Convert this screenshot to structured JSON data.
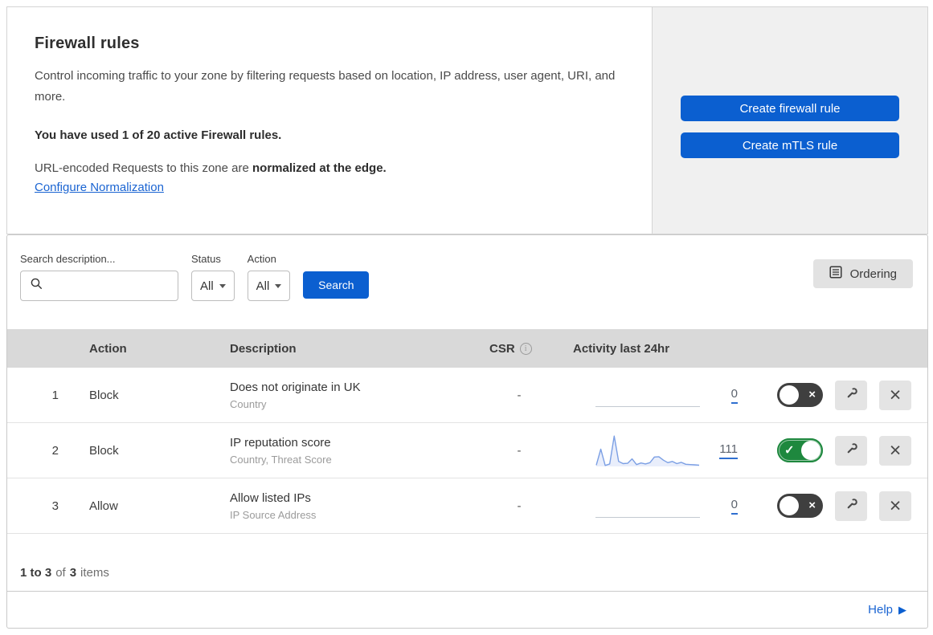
{
  "header": {
    "title": "Firewall rules",
    "description": "Control incoming traffic to your zone by filtering requests based on location, IP address, user agent, URI, and more.",
    "usage_line": "You have used 1 of 20 active Firewall rules.",
    "normalization_text": "URL-encoded Requests to this zone are ",
    "normalization_bold": "normalized at the edge.",
    "normalization_link": "Configure Normalization",
    "buttons": [
      {
        "label": "Create firewall rule"
      },
      {
        "label": "Create mTLS rule"
      }
    ]
  },
  "filters": {
    "search_label": "Search description...",
    "status_label": "Status",
    "status_value": "All",
    "action_label": "Action",
    "action_value": "All",
    "search_button": "Search",
    "ordering_button": "Ordering"
  },
  "table": {
    "columns": {
      "action": "Action",
      "description": "Description",
      "csr": "CSR",
      "activity": "Activity last 24hr"
    },
    "rows": [
      {
        "num": "1",
        "action": "Block",
        "title": "Does not originate in UK",
        "subtitle": "Country",
        "csr": "-",
        "count": "0",
        "enabled": false
      },
      {
        "num": "2",
        "action": "Block",
        "title": "IP reputation score",
        "subtitle": "Country, Threat Score",
        "csr": "-",
        "count": "111",
        "enabled": true,
        "sparkline": [
          4,
          55,
          3,
          8,
          97,
          16,
          9,
          10,
          24,
          6,
          11,
          8,
          12,
          30,
          31,
          20,
          12,
          16,
          9,
          13,
          7,
          6,
          5,
          4
        ]
      },
      {
        "num": "3",
        "action": "Allow",
        "title": "Allow listed IPs",
        "subtitle": "IP Source Address",
        "csr": "-",
        "count": "0",
        "enabled": false
      }
    ]
  },
  "footer": {
    "range_bold": "1 to 3",
    "of_text": "of",
    "total_bold": "3",
    "items_text": "items",
    "help_label": "Help"
  },
  "glyphs": {
    "close": "×",
    "check": "✓",
    "info": "i",
    "help_arrow": "▶"
  },
  "colors": {
    "primary_blue": "#0b5fd0",
    "link_blue": "#1a64d2",
    "toggle_on_green": "#1e883e",
    "toggle_off_dark": "#3f3f3f",
    "sparkline_blue": "#7b9fe4",
    "header_row_gray": "#d9d9d9"
  }
}
